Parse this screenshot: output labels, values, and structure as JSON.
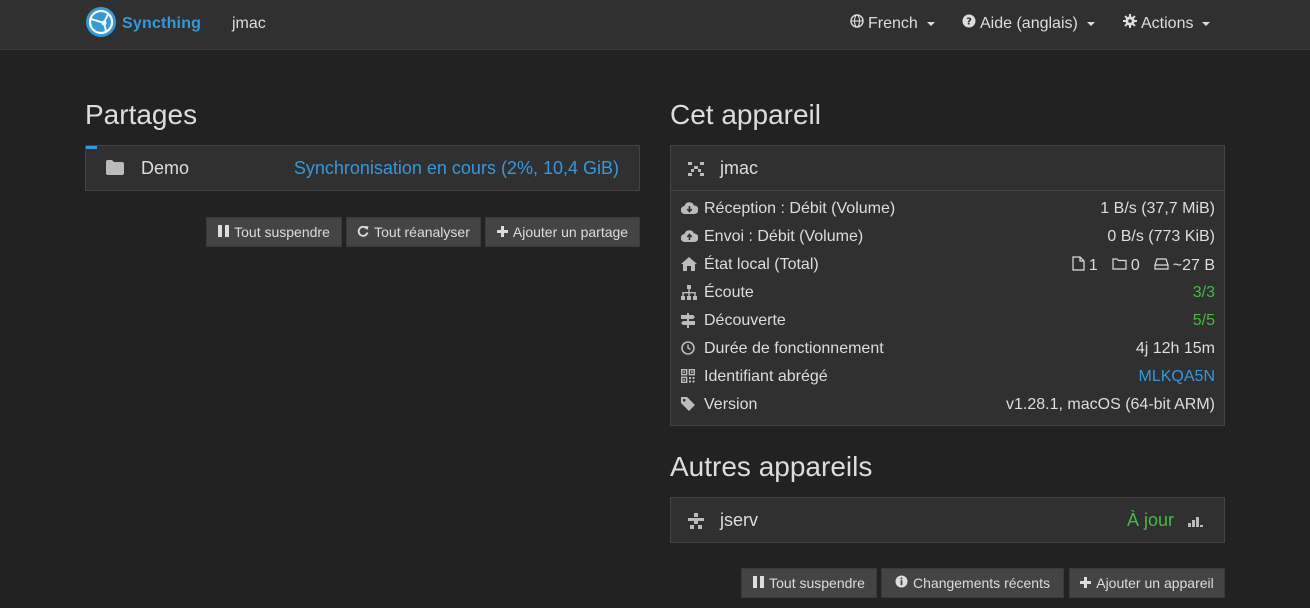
{
  "navbar": {
    "brand": "Syncthing",
    "hostname": "jmac",
    "language_menu": "French",
    "help_menu": "Aide (anglais)",
    "actions_menu": "Actions"
  },
  "folders": {
    "heading": "Partages",
    "items": [
      {
        "name": "Demo",
        "status": "Synchronisation en cours (2%, 10,4 GiB)",
        "progress_percent": 2
      }
    ],
    "buttons": {
      "pause_all": "Tout suspendre",
      "rescan_all": "Tout réanalyser",
      "add_folder": "Ajouter un partage"
    }
  },
  "this_device": {
    "heading": "Cet appareil",
    "name": "jmac",
    "rows": [
      {
        "icon": "cloud-download-icon",
        "label": "Réception : Débit (Volume)",
        "value": "1 B/s (37,7 MiB)"
      },
      {
        "icon": "cloud-upload-icon",
        "label": "Envoi : Débit (Volume)",
        "value": "0 B/s (773 KiB)"
      },
      {
        "icon": "home-icon",
        "label": "État local (Total)",
        "files": "1",
        "dirs": "0",
        "size": "~27 B"
      },
      {
        "icon": "sitemap-icon",
        "label": "Écoute",
        "value": "3/3"
      },
      {
        "icon": "signpost-icon",
        "label": "Découverte",
        "value": "5/5"
      },
      {
        "icon": "clock-icon",
        "label": "Durée de fonctionnement",
        "value": "4j 12h 15m"
      },
      {
        "icon": "qrcode-icon",
        "label": "Identifiant abrégé",
        "value": "MLKQA5N"
      },
      {
        "icon": "tag-icon",
        "label": "Version",
        "value": "v1.28.1, macOS (64-bit ARM)"
      }
    ]
  },
  "remote_devices": {
    "heading": "Autres appareils",
    "items": [
      {
        "name": "jserv",
        "status": "À jour"
      }
    ],
    "buttons": {
      "pause_all": "Tout suspendre",
      "recent_changes": "Changements récents",
      "add_device": "Ajouter un appareil"
    }
  },
  "colors": {
    "background": "#222222",
    "panel": "#303030",
    "accent": "#3399dd",
    "success": "#44bb44"
  }
}
